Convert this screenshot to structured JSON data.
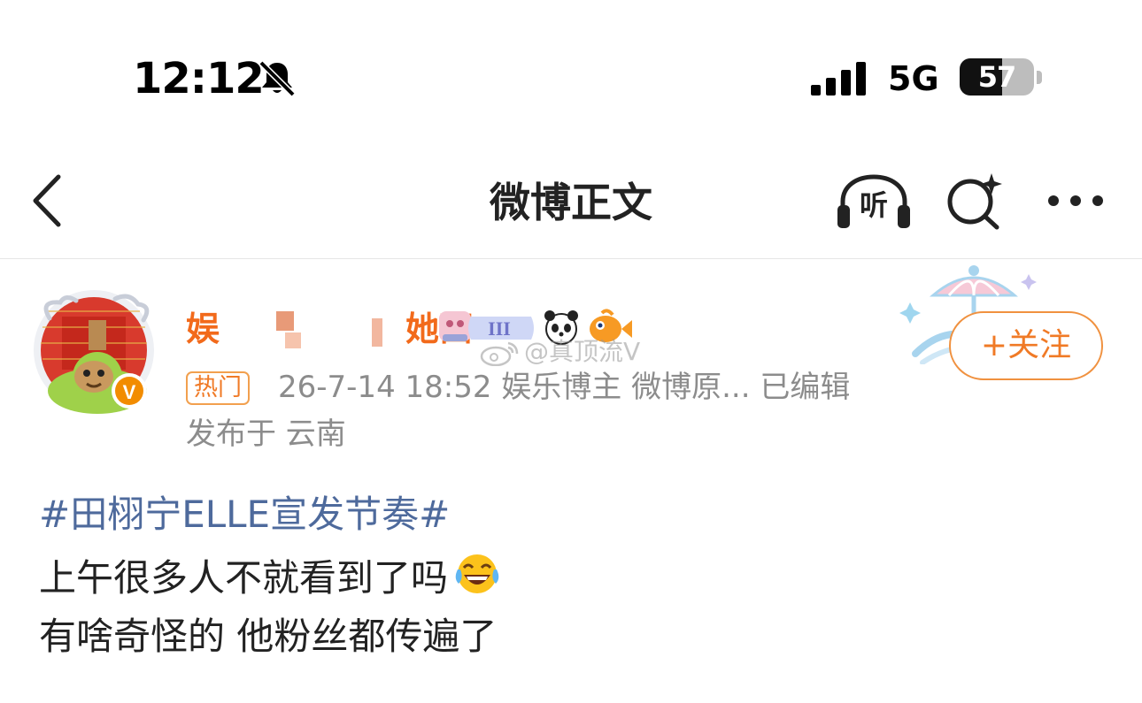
{
  "status_bar": {
    "time": "12:12",
    "network": "5G",
    "battery_level": "57",
    "battery_fraction": 0.57,
    "icons": [
      "bell-off-icon",
      "signal-icon",
      "battery-icon"
    ]
  },
  "nav": {
    "title": "微博正文",
    "listen_label": "听",
    "icons": [
      "back-icon",
      "listen-icon",
      "search-ai-icon",
      "more-icon"
    ]
  },
  "post": {
    "author": {
      "name_visible": "娱",
      "name_visible_end": "她西",
      "verified_badge": "V"
    },
    "watermark": "@真顶流V",
    "follow_label": "+关注",
    "hot_badge": "热门",
    "meta": "26-7-14 18:52  娱乐博主 微博原...  已编辑",
    "location": "发布于 云南",
    "hashtag": "#田栩宁ELLE宣发节奏#",
    "lines": [
      "上午很多人不就看到了吗",
      "有啥奇怪的 他粉丝都传遍了"
    ]
  },
  "colors": {
    "accent_orange": "#f07a26",
    "hashtag_blue": "#4e6a9c",
    "meta_gray": "#8c8c8c",
    "verified_orange": "#f28c00"
  }
}
